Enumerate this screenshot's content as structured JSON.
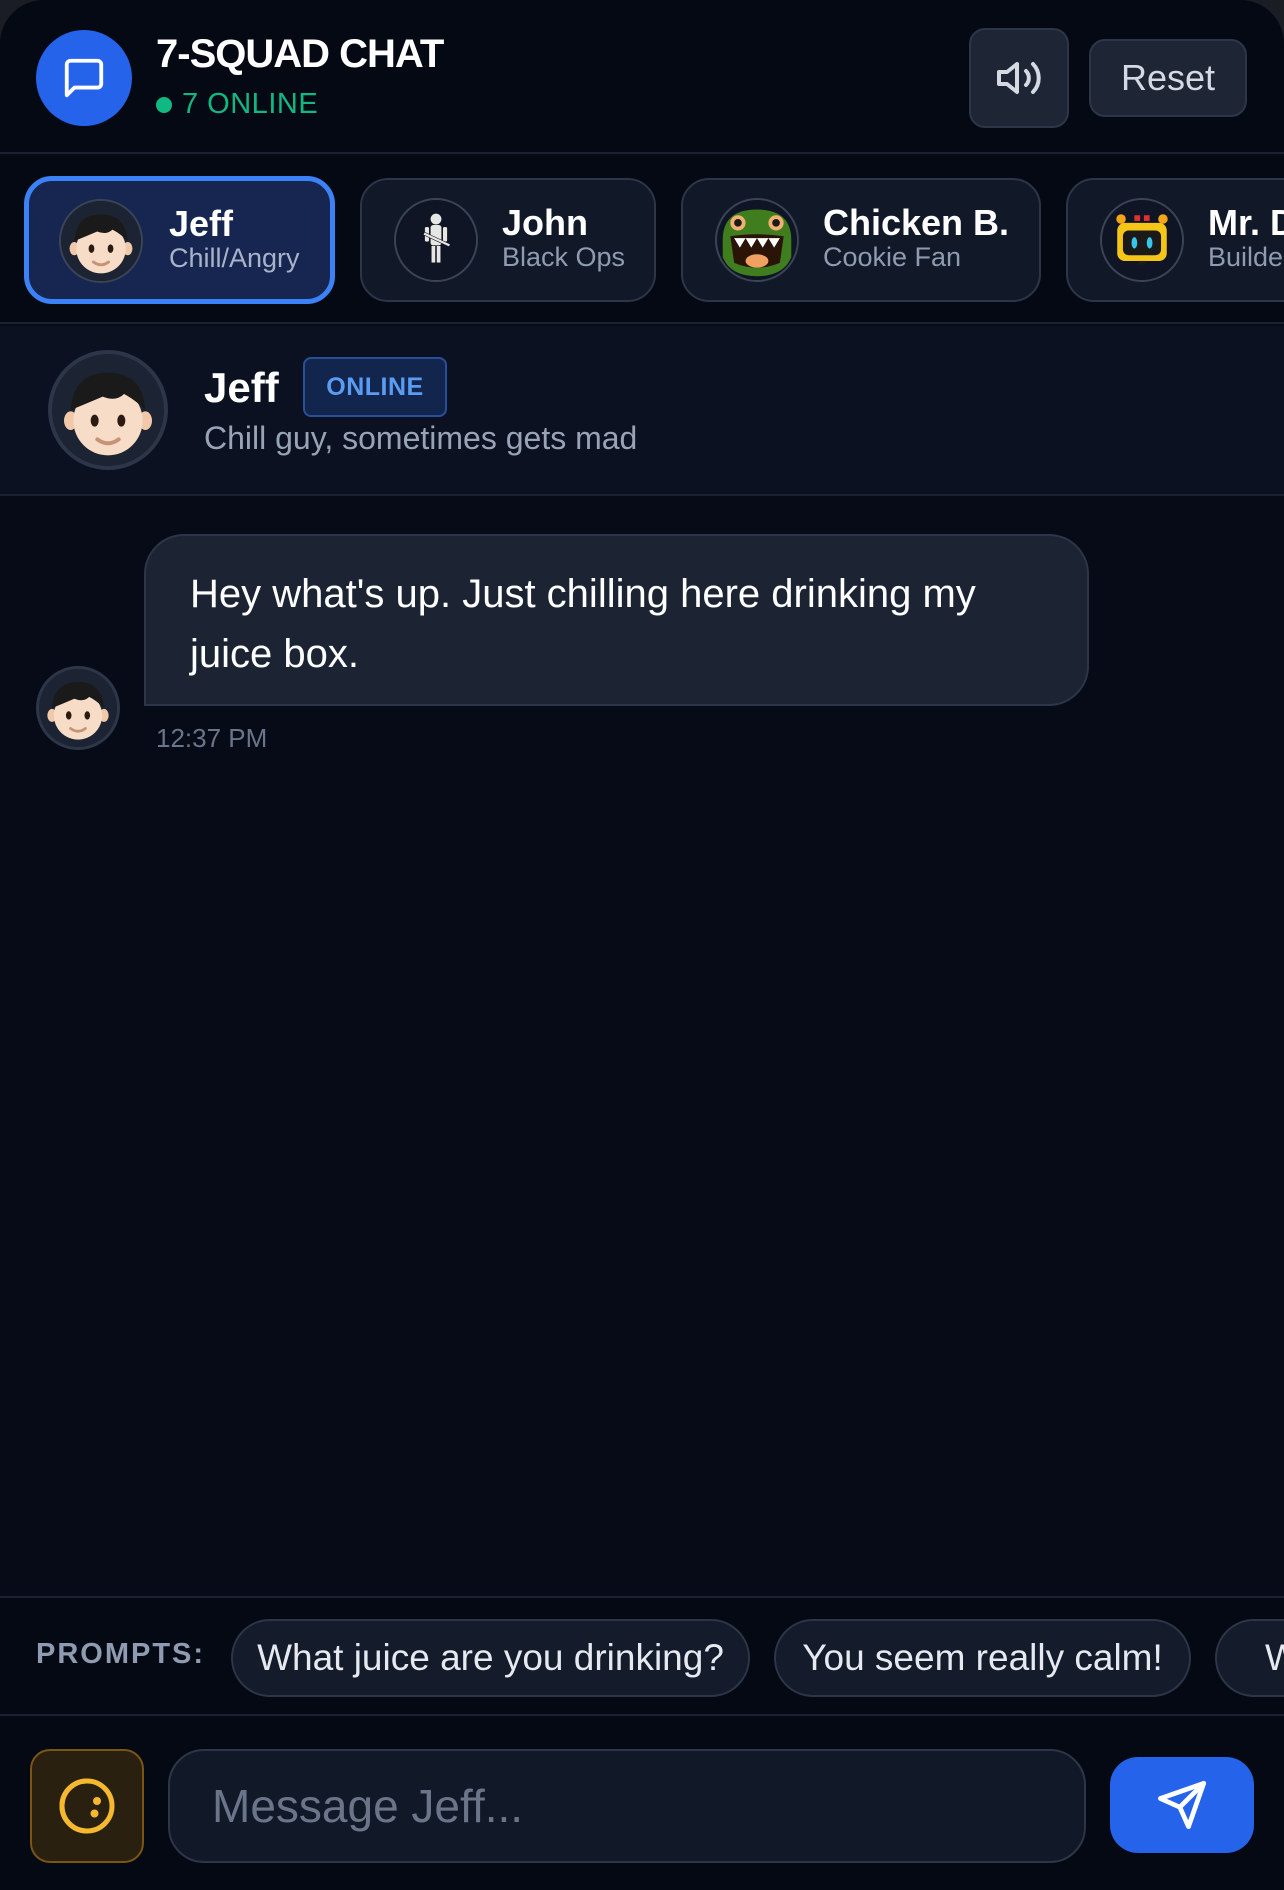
{
  "header": {
    "title": "7-SQUAD CHAT",
    "online_status": "7 ONLINE",
    "reset_label": "Reset",
    "logo_icon": "chat-bubble-icon",
    "sound_icon": "speaker-icon"
  },
  "characters": [
    {
      "name": "Jeff",
      "role": "Chill/Angry",
      "active": true,
      "icon": "boy-face-icon"
    },
    {
      "name": "John",
      "role": "Black Ops",
      "active": false,
      "icon": "soldier-icon"
    },
    {
      "name": "Chicken B.",
      "role": "Cookie Fan",
      "active": false,
      "icon": "green-monster-icon"
    },
    {
      "name": "Mr. D",
      "role": "Builder",
      "active": false,
      "icon": "yellow-robot-icon"
    }
  ],
  "profile": {
    "name": "Jeff",
    "status": "ONLINE",
    "description": "Chill guy, sometimes gets mad"
  },
  "messages": [
    {
      "text": "Hey what's up. Just chilling here drinking my juice box.",
      "time": "12:37 PM",
      "sender": "Jeff"
    }
  ],
  "prompts": {
    "label": "PROMPTS:",
    "items": [
      "What juice are you drinking?",
      "You seem really calm!",
      "W"
    ]
  },
  "composer": {
    "placeholder": "Message Jeff...",
    "mood_icon": "moon-face-icon",
    "send_icon": "paper-plane-icon"
  },
  "colors": {
    "accent": "#2563eb",
    "online": "#10b981",
    "background": "#070b18"
  }
}
